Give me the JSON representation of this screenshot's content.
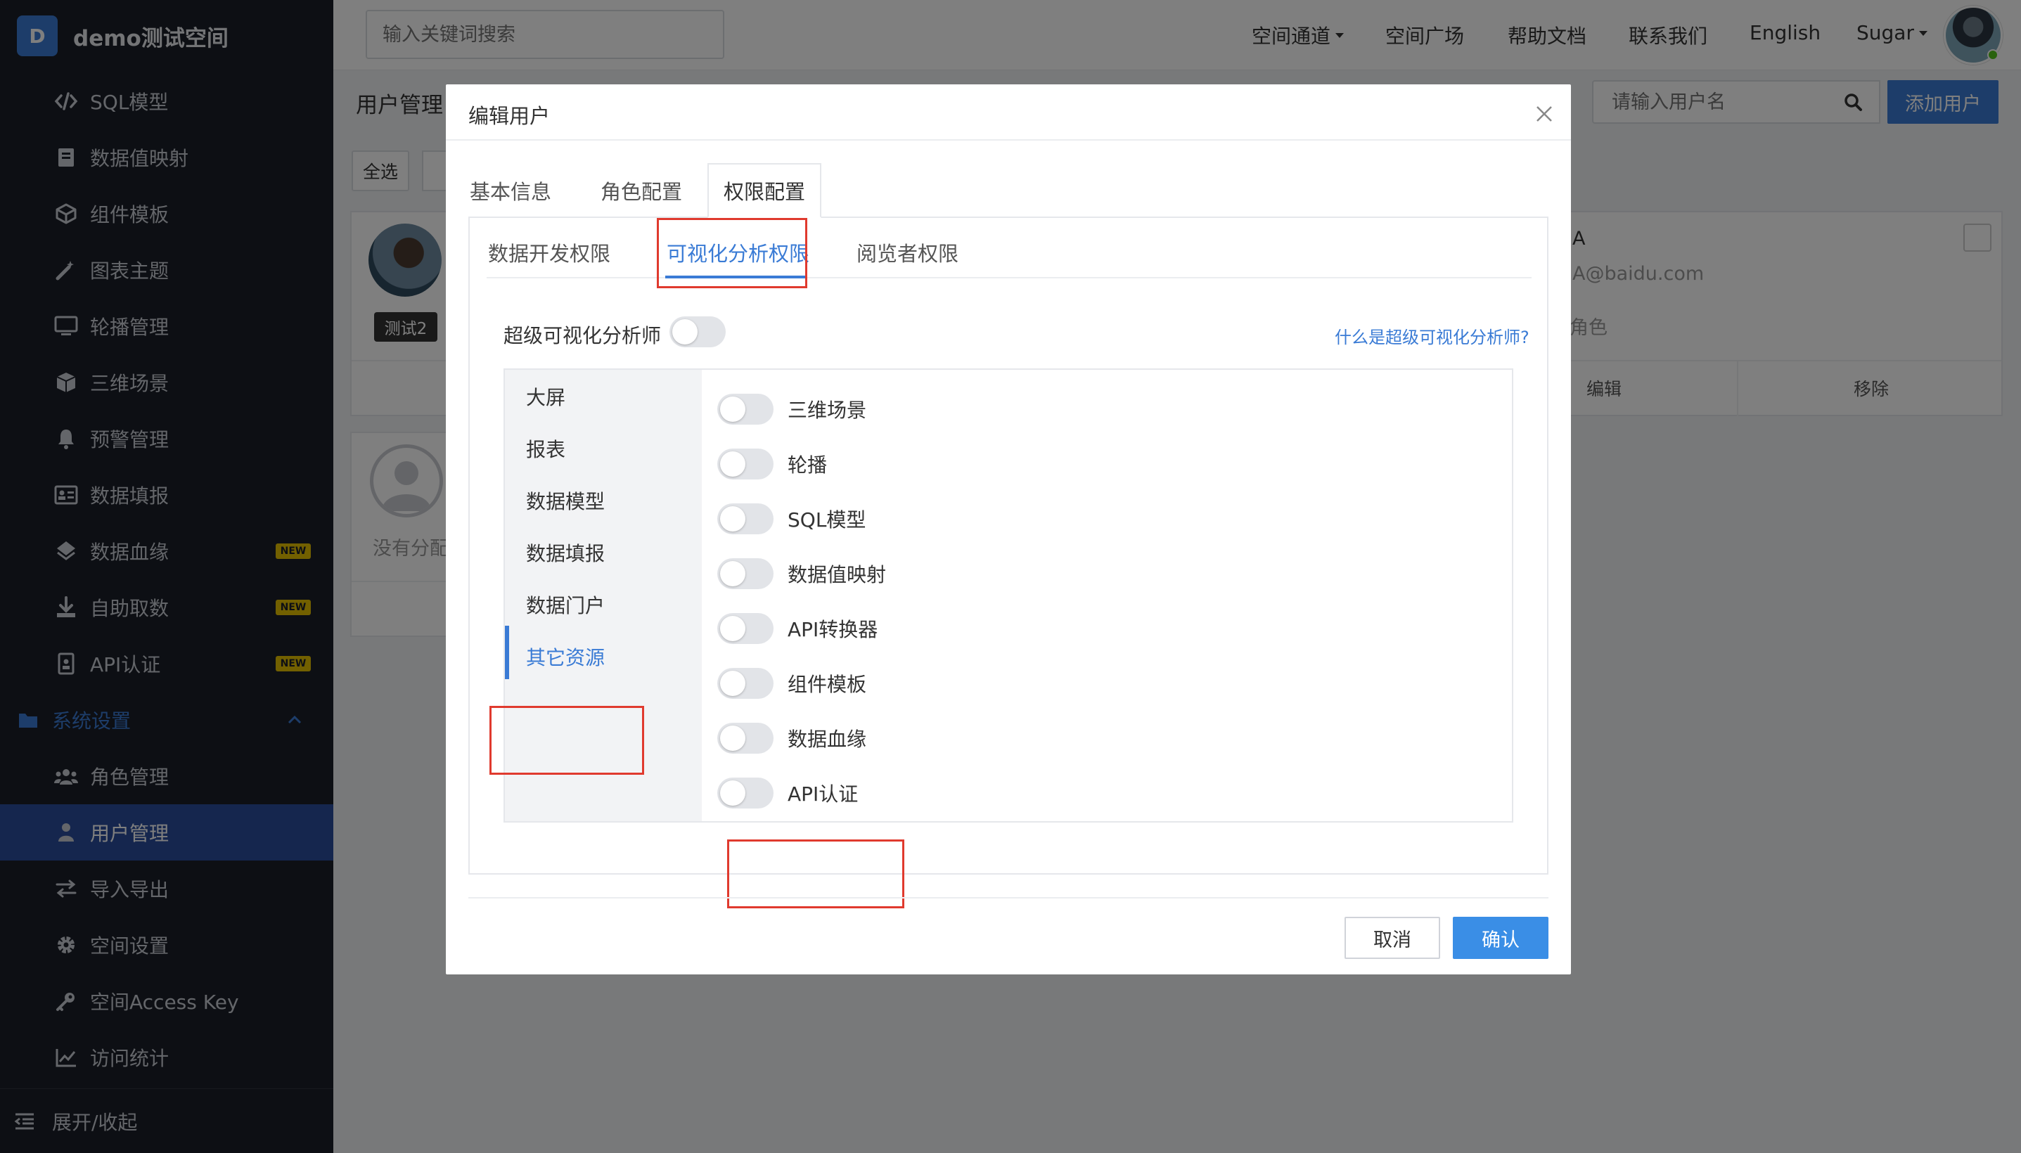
{
  "brand": {
    "badge": "D",
    "name": "demo测试空间"
  },
  "sidebar": {
    "items": [
      {
        "label": "SQL模型",
        "icon": "code-icon"
      },
      {
        "label": "数据值映射",
        "icon": "book-icon"
      },
      {
        "label": "组件模板",
        "icon": "cube-icon"
      },
      {
        "label": "图表主题",
        "icon": "magic-wand-icon"
      },
      {
        "label": "轮播管理",
        "icon": "monitor-icon"
      },
      {
        "label": "三维场景",
        "icon": "box-icon"
      },
      {
        "label": "预警管理",
        "icon": "bell-icon"
      },
      {
        "label": "数据填报",
        "icon": "form-card-icon"
      },
      {
        "label": "数据血缘",
        "icon": "layers-icon",
        "badge": "NEW"
      },
      {
        "label": "自助取数",
        "icon": "download-icon",
        "badge": "NEW"
      },
      {
        "label": "API认证",
        "icon": "id-badge-icon",
        "badge": "NEW"
      }
    ],
    "group": {
      "label": "系统设置",
      "icon": "folder-icon"
    },
    "sub_items": [
      {
        "label": "角色管理",
        "icon": "users-icon"
      },
      {
        "label": "用户管理",
        "icon": "user-icon",
        "active": true
      },
      {
        "label": "导入导出",
        "icon": "exchange-icon"
      },
      {
        "label": "空间设置",
        "icon": "gear-icon"
      },
      {
        "label": "空间Access Key",
        "icon": "key-icon"
      },
      {
        "label": "访问统计",
        "icon": "line-chart-icon"
      }
    ],
    "footer": {
      "label": "展开/收起",
      "icon": "collapse-icon"
    }
  },
  "topbar": {
    "search_placeholder": "输入关键词搜索",
    "links": [
      "空间通道",
      "空间广场",
      "帮助文档",
      "联系我们",
      "English",
      "Sugar"
    ]
  },
  "page": {
    "title": "用户管理",
    "user_search_placeholder": "请输入用户名",
    "add_user": "添加用户",
    "select_all": "全选",
    "card1": {
      "tag": "测试2",
      "name_frag": "A",
      "email_frag": "A@baidu.com",
      "role_frag": "角色",
      "edit": "编辑",
      "remove": "移除"
    },
    "card2": {
      "text_frag": "没有分配"
    }
  },
  "modal": {
    "title": "编辑用户",
    "tabs": [
      "基本信息",
      "角色配置",
      "权限配置"
    ],
    "subtabs": [
      "数据开发权限",
      "可视化分析权限",
      "阅览者权限"
    ],
    "super_analyst_label": "超级可视化分析师",
    "super_analyst_help": "什么是超级可视化分析师?",
    "categories": [
      "大屏",
      "报表",
      "数据模型",
      "数据填报",
      "数据门户",
      "其它资源"
    ],
    "permissions": [
      "三维场景",
      "轮播",
      "SQL模型",
      "数据值映射",
      "API转换器",
      "组件模板",
      "数据血缘",
      "API认证"
    ],
    "cancel": "取消",
    "confirm": "确认"
  },
  "colors": {
    "accent": "#3a7bd5",
    "sidebar_bg": "#1b1f28",
    "highlight_red": "#e03a2e",
    "new_badge": "#e5c100"
  }
}
